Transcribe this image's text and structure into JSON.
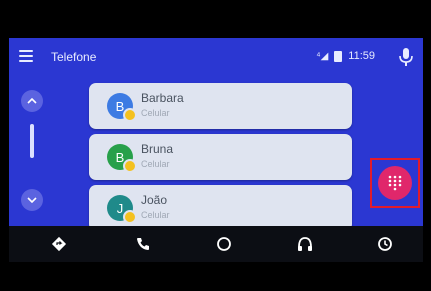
{
  "app": {
    "title": "Telefone",
    "time": "11:59",
    "network": "⁴◢"
  },
  "contacts": [
    {
      "name": "Barbara",
      "type": "Celular",
      "initial": "B",
      "color": "#3d7be3"
    },
    {
      "name": "Bruna",
      "type": "Celular",
      "initial": "B",
      "color": "#28a04a"
    },
    {
      "name": "João",
      "type": "Celular",
      "initial": "J",
      "color": "#1f8a8a"
    }
  ],
  "icons": {
    "menu": "hamburger-menu-icon",
    "battery": "battery-icon",
    "microphone": "microphone-icon",
    "scroll_up": "chevron-up-icon",
    "scroll_down": "chevron-down-icon",
    "dialpad": "dialpad-icon",
    "nav": [
      "navigation-icon",
      "phone-icon",
      "home-icon",
      "headphones-icon",
      "recents-icon"
    ]
  },
  "colors": {
    "appbar": "#2b37d2",
    "card": "#dfe4f0",
    "dial_button": "#e0276b",
    "highlight": "#e11b2c"
  }
}
